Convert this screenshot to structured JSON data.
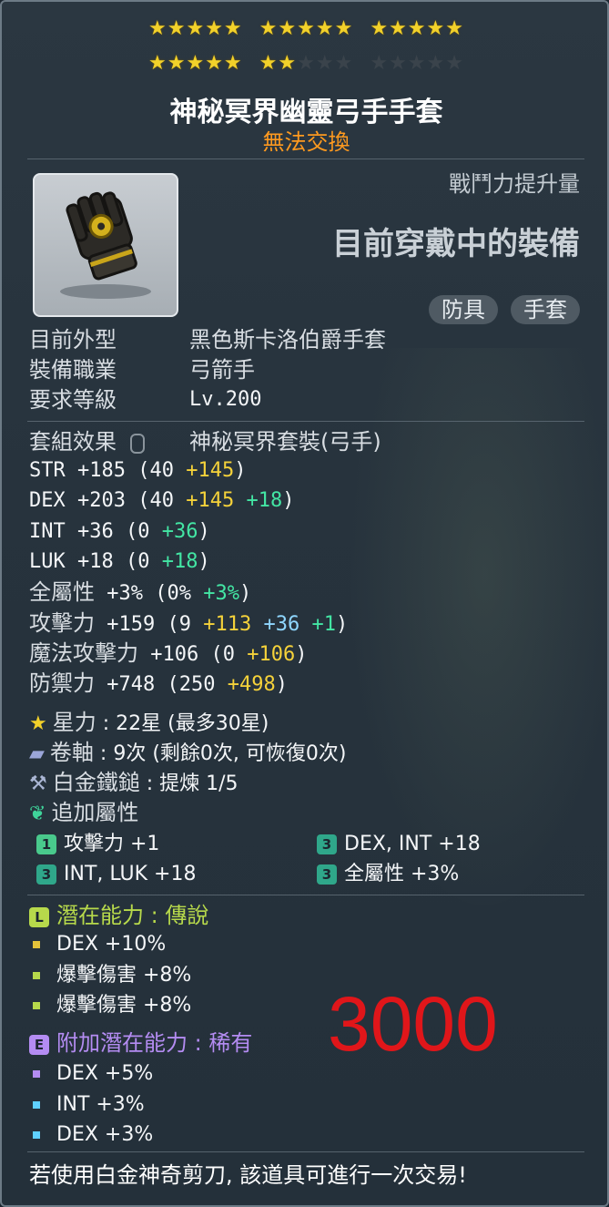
{
  "stars": {
    "filled": 22,
    "max": 30,
    "rows": [
      [
        [
          1,
          1,
          1,
          1,
          1
        ],
        [
          1,
          1,
          1,
          1,
          1
        ],
        [
          1,
          1,
          1,
          1,
          1
        ]
      ],
      [
        [
          1,
          1,
          1,
          1,
          1
        ],
        [
          1,
          1,
          0,
          0,
          0
        ],
        [
          0,
          0,
          0,
          0,
          0
        ]
      ]
    ]
  },
  "item": {
    "name": "神秘冥界幽靈弓手手套",
    "trade_status": "無法交換",
    "power_label": "戰鬥力提升量",
    "equipped_label": "目前穿戴中的裝備",
    "icon": "gloves-icon",
    "tags": [
      "防具",
      "手套"
    ]
  },
  "info": [
    {
      "label": "目前外型",
      "value": "黑色斯卡洛伯爵手套"
    },
    {
      "label": "裝備職業",
      "value": "弓箭手"
    },
    {
      "label": "要求等級",
      "value": "Lv.200"
    }
  ],
  "set": {
    "label": "套組效果",
    "value": "神秘冥界套裝(弓手)",
    "icon": "mouse-icon"
  },
  "stats": [
    {
      "name": "STR",
      "total": "+185",
      "base": "(40",
      "parts": [
        {
          "text": "+145",
          "color": "y"
        }
      ],
      "close": ")"
    },
    {
      "name": "DEX",
      "total": "+203",
      "base": "(40",
      "parts": [
        {
          "text": "+145",
          "color": "y"
        },
        {
          "text": "+18",
          "color": "g"
        }
      ],
      "close": ")"
    },
    {
      "name": "INT",
      "total": "+36",
      "base": "(0",
      "parts": [
        {
          "text": "+36",
          "color": "g"
        }
      ],
      "close": ")"
    },
    {
      "name": "LUK",
      "total": "+18",
      "base": "(0",
      "parts": [
        {
          "text": "+18",
          "color": "g"
        }
      ],
      "close": ")"
    },
    {
      "name": "全屬性",
      "total": "+3%",
      "base": "(0%",
      "parts": [
        {
          "text": "+3%",
          "color": "g"
        }
      ],
      "close": ")"
    },
    {
      "name": "攻擊力",
      "total": "+159",
      "base": "(9",
      "parts": [
        {
          "text": "+113",
          "color": "y"
        },
        {
          "text": "+36",
          "color": "b"
        },
        {
          "text": "+1",
          "color": "g"
        }
      ],
      "close": ")"
    },
    {
      "name": "魔法攻擊力",
      "total": "+106",
      "base": "(0",
      "parts": [
        {
          "text": "+106",
          "color": "y"
        }
      ],
      "close": ")"
    },
    {
      "name": "防禦力",
      "total": "+748",
      "base": "(250",
      "parts": [
        {
          "text": "+498",
          "color": "y"
        }
      ],
      "close": ")"
    }
  ],
  "misc": [
    {
      "icon": "star-icon",
      "label": "星力",
      "sep": ":",
      "value": "22星 (最多30星)"
    },
    {
      "icon": "scroll-icon",
      "label": "卷軸",
      "sep": ":",
      "value": "9次 (剩餘0次, 可恢復0次)"
    },
    {
      "icon": "hammer-icon",
      "label": "白金鐵鎚",
      "sep": ":",
      "value": "提煉 1/5"
    },
    {
      "icon": "leaf-icon",
      "label": "追加屬性",
      "sep": "",
      "value": ""
    }
  ],
  "bonus": [
    {
      "badge": "1",
      "text": "攻擊力 +1"
    },
    {
      "badge": "3",
      "text": "DEX, INT  +18"
    },
    {
      "badge": "3",
      "text": "INT, LUK  +18"
    },
    {
      "badge": "3",
      "text": "全屬性 +3%"
    }
  ],
  "potential": {
    "badge": "L",
    "title": "潛在能力",
    "tier": "傳說",
    "lines": [
      "DEX +10%",
      "爆擊傷害 +8%",
      "爆擊傷害 +8%"
    ]
  },
  "bonus_potential": {
    "badge": "E",
    "title": "附加潛在能力",
    "tier": "稀有",
    "lines": [
      "DEX +5%",
      "INT +3%",
      "DEX +3%"
    ]
  },
  "overlay_text": "3000",
  "footer": "若使用白金神奇剪刀, 該道具可進行一次交易!",
  "colors": {
    "trade": "#ff9a1f",
    "star_on": "#f2d12a",
    "legendary": "#b7d94b",
    "rare": "#b48cf2",
    "overlay": "#e0161a"
  }
}
